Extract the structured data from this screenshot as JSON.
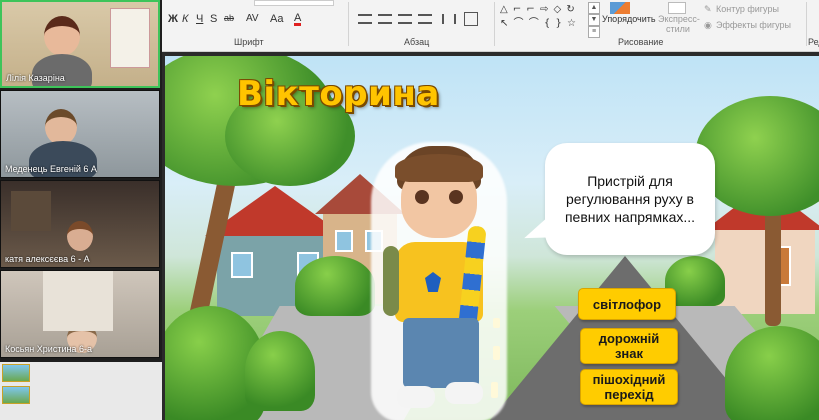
{
  "video_call": {
    "participants": [
      {
        "name": "Лілія Казаріна"
      },
      {
        "name": "Меденець Евгеній 6 А"
      },
      {
        "name": "катя алексєєва 6 - А"
      },
      {
        "name": "Косьян Христина 6-а"
      }
    ]
  },
  "ribbon": {
    "format_buttons": [
      "Ж",
      "К",
      "Ч",
      "S",
      "ab",
      "AV",
      "Aa",
      "A"
    ],
    "group_font": "Шрифт",
    "group_paragraph": "Абзац",
    "group_drawing": "Рисование",
    "group_edit_truncated": "Ред",
    "arrange_label": "Упорядочить",
    "express_styles_label": "Экспресс-стили",
    "shape_outline_label": "Контур фигуры",
    "shape_effects_label": "Эффекты фигуры",
    "shape_gallery": "△ ⌐ ⌐ ⇨ ◇ ↻\n↖ ⌒ ⌒ { } ☆"
  },
  "slide": {
    "title": "Вікторина",
    "question": "Пристрій для регулювання руху в певних напрямках...",
    "answers": [
      {
        "label": "світлофор"
      },
      {
        "label": "дорожній знак"
      },
      {
        "label": "пішохідний перехід"
      }
    ]
  },
  "colors": {
    "accent_yellow": "#ffcc00",
    "title_yellow": "#ffc400",
    "active_tile_border": "#3ec45a"
  }
}
